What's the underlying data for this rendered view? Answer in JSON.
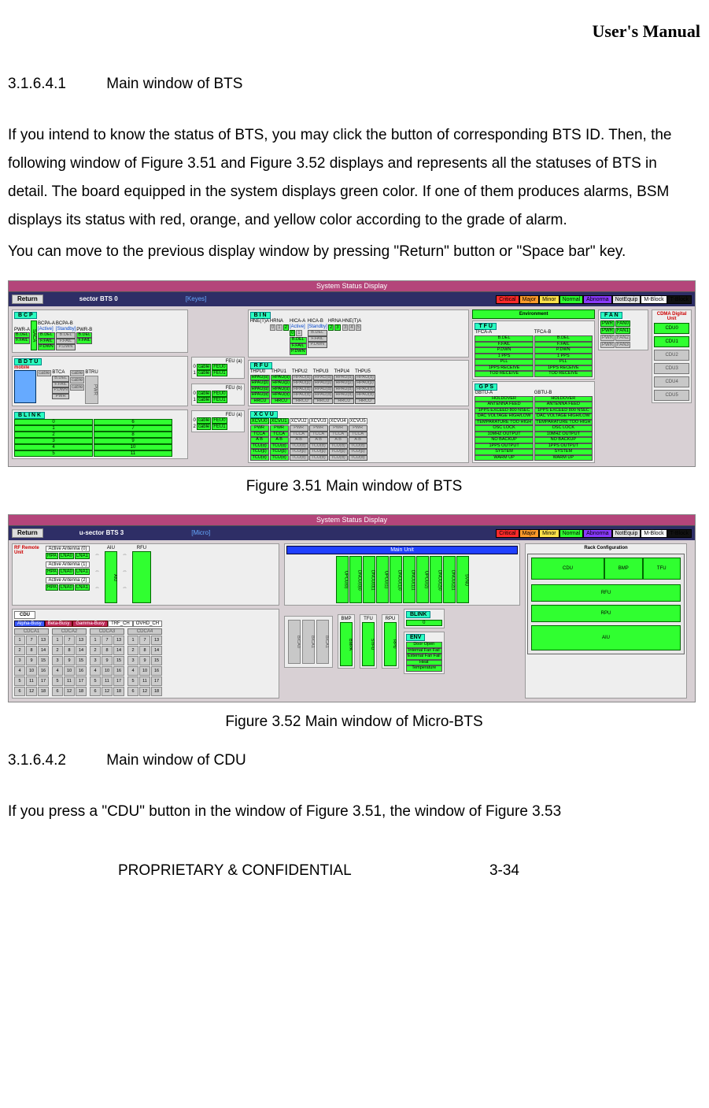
{
  "header": {
    "title": "User's Manual"
  },
  "section1": {
    "number": "3.1.6.4.1",
    "title": "Main window of BTS",
    "para1": "If you intend to know the status of BTS, you may click the button of corresponding BTS ID. Then, the following window of Figure 3.51 and Figure 3.52 displays and represents all the statuses of BTS in detail. The board equipped in the system displays green color. If one of them produces alarms, BSM displays its status with red, orange, and yellow color according to the grade of alarm.",
    "para2": "You can move to the previous display window by pressing \"Return\" button or \"Space bar\" key."
  },
  "figure51": {
    "titlebar": "System Status Display",
    "toolbar": {
      "return": "Return",
      "label": "sector BTS    0",
      "bracket": "[Keyes]"
    },
    "legend": {
      "critical": "Critical",
      "major": "Major",
      "minor": "Minor",
      "normal": "Normal",
      "abnormal": "Abnorma",
      "notequip": "NotEquip",
      "mblock": "M-Block",
      "tblock": "T-Block"
    },
    "bcp": {
      "label": "B C P",
      "pwr_a": "PWR-A",
      "pwr_b": "PWR-B",
      "saca": "SACA",
      "bcpa_a": "BCPA-A",
      "bcpa_a_state": "[Active]",
      "bcpa_b": "BCPA-B",
      "bcpa_b_state": "[Standby]",
      "lines": [
        "B.DEL",
        "F.FAIL",
        "P.DWN"
      ],
      "side": [
        "B.DEL",
        "F.FAIL"
      ]
    },
    "bdtu": {
      "label": "B D T U",
      "mobile": "mobile",
      "btca": "BTCA",
      "btru": "BTRU",
      "cable": "cable",
      "pwr": "PWR",
      "lines": [
        "B.DEL",
        "F.FAIL",
        "P.DWN",
        "PWR"
      ]
    },
    "blink": {
      "label": "B L I N K",
      "rows_left": [
        "0",
        "1",
        "2",
        "3",
        "4",
        "5"
      ],
      "rows_right": [
        "6",
        "7",
        "8",
        "9",
        "10",
        "11"
      ]
    },
    "bin": {
      "label": "B I N",
      "cols": [
        "HNE(T)A",
        "HRNA",
        "HICA-A",
        "HICA-B",
        "HRNA",
        "HNE(T)A"
      ],
      "hica_a_state": "[Active]",
      "hica_b_state": "[Standby]",
      "nums_l": [
        "0",
        "1",
        "2"
      ],
      "nums_m": [
        "0",
        "1"
      ],
      "nums_r": [
        "2",
        "3",
        "3",
        "4",
        "5"
      ],
      "lines": [
        "B.DEL",
        "F.FAIL",
        "P.DWN"
      ]
    },
    "rfu": {
      "label": "R F U",
      "feu": [
        "FEU (a)",
        "FEU (b)",
        "FEU (a)"
      ],
      "feu_items": [
        "cable",
        "FEU0",
        "cable",
        "FEU1"
      ],
      "thp_cols": [
        "THPU0",
        "THPU1",
        "THPU2",
        "THPU3",
        "THPU4",
        "THPU5"
      ],
      "hp_rows": [
        "HPAU(α)",
        "HPAU(β)",
        "HPAU(α)",
        "HPAU(α)",
        "HRCU"
      ]
    },
    "xcvu": {
      "label": "X C V U",
      "cols": [
        "XCVU0",
        "XCVU1",
        "XCVU2",
        "XCVU3",
        "XCVU4",
        "XCVU5"
      ],
      "rows": [
        "PWR",
        "TCCA",
        "A  B",
        "TCU(α)",
        "TCU(β)",
        "TCU(α)"
      ]
    },
    "env": {
      "button": "Environment",
      "tfu": "T F U",
      "tfca_a": "TFCA-A",
      "tfca_b": "TFCA-B",
      "tfca_lines": [
        "B.DEL",
        "F.FAIL",
        "P.DWN",
        "1 PPS",
        "PLL",
        "1PPS RECEIVE",
        "TOD RECEIVE"
      ],
      "gps": "G P S",
      "gbtu_a": "GBTU-A",
      "gbtu_b": "GBTU-B",
      "gps_lines": [
        "HOLDOVER",
        "ANTENNA FEED",
        "1PPS EXCEED 800 NSEC",
        "DAC VOLTAGE HIGH/LOW",
        "TEMPARATURE TOO HIGH",
        "OSC LOCK",
        "10MHZ OUTPUT",
        "NO BACKUP",
        "1PPS OUTPUT",
        "SYSTEM",
        "WARM UP"
      ]
    },
    "fan": {
      "label": "F A N",
      "rows": [
        [
          "PWR",
          "FAN0"
        ],
        [
          "PWR",
          "FAN1"
        ],
        [
          "PWR",
          "FAN2"
        ],
        [
          "PWR",
          "FAN3"
        ]
      ]
    },
    "cdma": {
      "title": "CDMA Digital Unit",
      "units": [
        "CDU0",
        "CDU1",
        "CDU2",
        "CDU3",
        "CDU4",
        "CDU5"
      ]
    },
    "caption": "Figure 3.51 Main window of BTS"
  },
  "figure52": {
    "titlebar": "System Status Display",
    "toolbar": {
      "return": "Return",
      "label": "u-sector BTS    3",
      "bracket": "[Micro]"
    },
    "rf": {
      "title": "RF Remote Unit",
      "antennas": [
        "Active Antenna (0)",
        "Active Antenna (1)",
        "Active Antenna (2)"
      ],
      "row": [
        "HPA",
        "LNA0",
        "LNA1"
      ],
      "aiu": "AIU",
      "rfu": "RFU",
      "aiu_v": "AIU"
    },
    "main_unit": {
      "title": "Main Unit",
      "slots": [
        "UPCU(0)",
        "DNCU(0)0",
        "DNCU(0)1",
        "UPCU(1)",
        "DNCU(1)0",
        "DNCU(1)1",
        "UPCU(2)",
        "DNCU(2)0",
        "DNCU(2)1",
        "SVNU"
      ]
    },
    "rack": {
      "title": "Rack Configuration",
      "row1": [
        "CDU",
        "BMP",
        "TFU"
      ],
      "rows": [
        "RFU",
        "RPU",
        "AIU"
      ]
    },
    "cdu": {
      "label": "CDU",
      "tabs": [
        "Alpha-Busy",
        "Beta-Busy",
        "Gamma-Busy",
        "TRF_CH",
        "OVHD_CH"
      ],
      "groups": [
        "CDCA1",
        "CDCA2",
        "CDCA3",
        "CDCA4"
      ],
      "cells": [
        "1",
        "7",
        "13",
        "2",
        "8",
        "14",
        "3",
        "9",
        "15",
        "4",
        "10",
        "16",
        "5",
        "11",
        "17",
        "6",
        "12",
        "18"
      ]
    },
    "mid": {
      "bica": [
        "BICA0",
        "BICA1",
        "BICA1"
      ],
      "bmp": "BMP",
      "tfu": "TFU",
      "rpu": "RPU",
      "bmpa": "BMPA",
      "stfu": "STFU",
      "rpu_v": "RPU"
    },
    "blink": {
      "label": "BLINK",
      "val": "0"
    },
    "env": {
      "label": "ENV",
      "rows": [
        "Door Open",
        "Internal Fan Fail",
        "External Fan Fail",
        "Heat",
        "Temperature"
      ]
    },
    "caption": "Figure 3.52 Main window of Micro-BTS"
  },
  "section2": {
    "number": "3.1.6.4.2",
    "title": "Main window of CDU",
    "para": "If you press a \"CDU\" button in the window of Figure 3.51, the window of Figure 3.53"
  },
  "footer": {
    "left": "PROPRIETARY & CONFIDENTIAL",
    "right": "3-34"
  }
}
